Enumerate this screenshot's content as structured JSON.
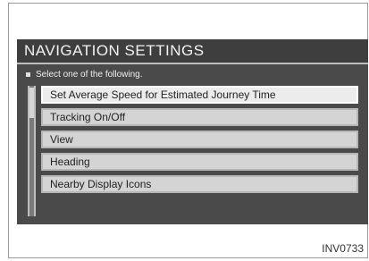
{
  "header": {
    "title": "NAVIGATION SETTINGS"
  },
  "instruction": "Select one of the following.",
  "menu": {
    "items": [
      {
        "label": "Set Average Speed for Estimated Journey Time",
        "selected": true
      },
      {
        "label": "Tracking On/Off",
        "selected": false
      },
      {
        "label": "View",
        "selected": false
      },
      {
        "label": "Heading",
        "selected": false
      },
      {
        "label": "Nearby Display Icons",
        "selected": false
      }
    ]
  },
  "caption": "INV0733",
  "colors": {
    "screen_background": "#4a4a4a",
    "menu_item": "#d4d4d4",
    "menu_item_selected": "#ececec",
    "title_text": "#f2f2f2"
  }
}
